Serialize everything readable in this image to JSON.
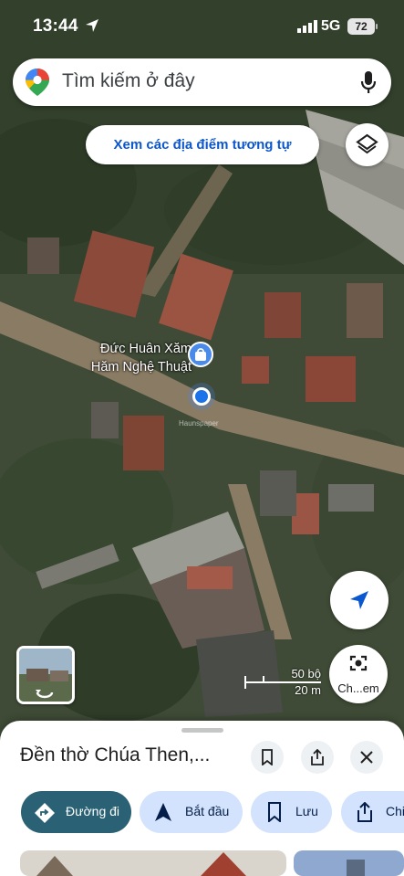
{
  "status_bar": {
    "time": "13:44",
    "network": "5G",
    "battery": "72"
  },
  "search": {
    "placeholder": "Tìm kiếm ở đây"
  },
  "chip": {
    "label": "Xem các địa điểm tương tự"
  },
  "map": {
    "poi_label_line1": "Đức Huân Xăm",
    "poi_label_line2": "Hăm Nghệ Thuật",
    "watermark": "Haunspaper",
    "scale": {
      "top": "50 bộ",
      "bottom": "20 m"
    }
  },
  "lens": {
    "label": "Ch...em"
  },
  "sheet": {
    "title": "Đền thờ Chúa Then,...",
    "actions": [
      {
        "label": "Đường đi",
        "icon": "directions-icon"
      },
      {
        "label": "Bắt đầu",
        "icon": "navigation-arrow-icon"
      },
      {
        "label": "Lưu",
        "icon": "bookmark-icon"
      },
      {
        "label": "Chi",
        "icon": "share-icon"
      }
    ]
  },
  "colors": {
    "accent": "#0b57d0",
    "primary_button": "#2a6174",
    "chip_text": "#0b57d0",
    "location_dot": "#1a73e8"
  }
}
